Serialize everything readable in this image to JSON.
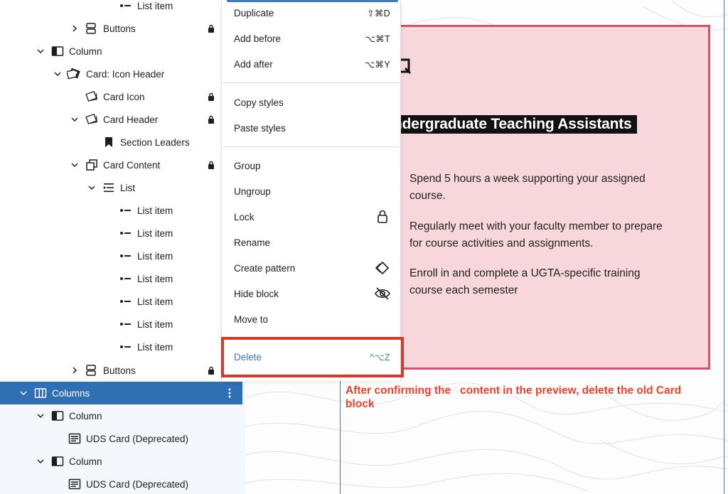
{
  "list_view": {
    "rows": [
      {
        "label": "List item",
        "icon": "list-item-icon"
      },
      {
        "label": "Buttons",
        "icon": "buttons-icon"
      },
      {
        "label": "Column",
        "icon": "column-icon"
      },
      {
        "label": "Card: Icon Header",
        "icon": "card-icon-header-icon"
      },
      {
        "label": "Card Icon",
        "icon": "card-icon"
      },
      {
        "label": "Card Header",
        "icon": "card-icon"
      },
      {
        "label": "Section Leaders",
        "icon": "bookmark-icon"
      },
      {
        "label": "Card Content",
        "icon": "copy-icon"
      },
      {
        "label": "List",
        "icon": "list-icon"
      },
      {
        "label": "List item",
        "icon": "list-item-icon"
      },
      {
        "label": "List item",
        "icon": "list-item-icon"
      },
      {
        "label": "List item",
        "icon": "list-item-icon"
      },
      {
        "label": "List item",
        "icon": "list-item-icon"
      },
      {
        "label": "List item",
        "icon": "list-item-icon"
      },
      {
        "label": "List item",
        "icon": "list-item-icon"
      },
      {
        "label": "List item",
        "icon": "list-item-icon"
      },
      {
        "label": "Buttons",
        "icon": "buttons-icon"
      },
      {
        "label": "Columns",
        "icon": "columns-icon"
      },
      {
        "label": "Column",
        "icon": "column-icon"
      },
      {
        "label": "UDS Card (Deprecated)",
        "icon": "card-block-icon"
      },
      {
        "label": "Column",
        "icon": "column-icon"
      },
      {
        "label": "UDS Card (Deprecated)",
        "icon": "card-block-icon"
      }
    ],
    "selected_color": "#2f6fb3"
  },
  "menu": {
    "duplicate": {
      "label": "Duplicate",
      "shortcut": "⇧⌘D"
    },
    "add_before": {
      "label": "Add before",
      "shortcut": "⌥⌘T"
    },
    "add_after": {
      "label": "Add after",
      "shortcut": "⌥⌘Y"
    },
    "copy_styles": {
      "label": "Copy styles"
    },
    "paste_styles": {
      "label": "Paste styles"
    },
    "group": {
      "label": "Group"
    },
    "ungroup": {
      "label": "Ungroup"
    },
    "lock": {
      "label": "Lock"
    },
    "rename": {
      "label": "Rename"
    },
    "create_pattern": {
      "label": "Create pattern"
    },
    "hide_block": {
      "label": "Hide block"
    },
    "move_to": {
      "label": "Move to"
    },
    "delete": {
      "label": "Delete",
      "shortcut": "^⌥Z"
    },
    "delete_color": "#3a79c0",
    "highlight_color": "#d53a2a"
  },
  "canvas": {
    "card": {
      "title": "ndergraduate Teaching Assistants",
      "bullets": [
        "Spend 5 hours a week supporting your assigned course.",
        "Regularly meet with your faculty member to prepare for course activities and assignments.",
        "Enroll in and complete a UGTA-specific training course each semester"
      ],
      "background": "#f7d7dc",
      "border_color": "#d5506a"
    },
    "annotation": "After confirming the   content in the preview, delete the old Card block",
    "annotation_color": "#e8412c"
  }
}
